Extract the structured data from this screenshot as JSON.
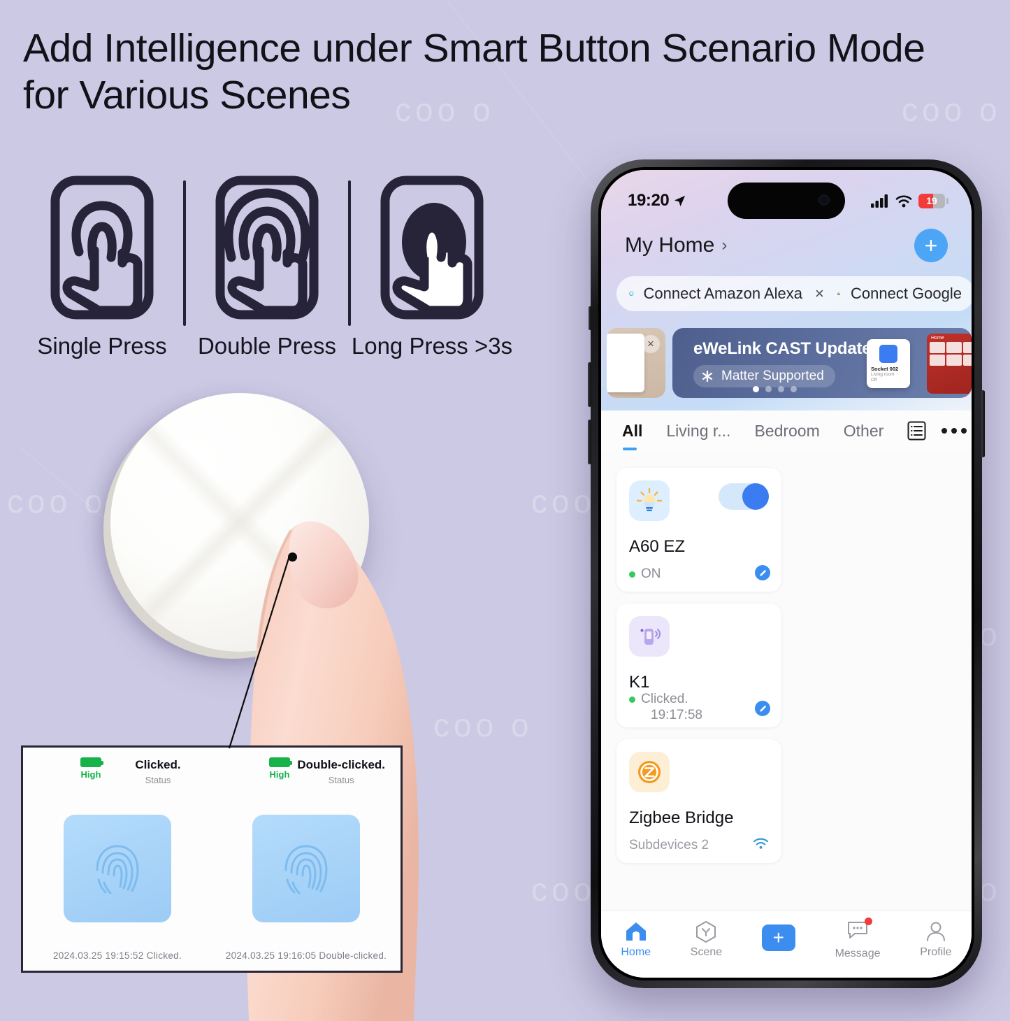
{
  "headline": "Add Intelligence under Smart Button Scenario Mode for Various Scenes",
  "watermark": "coo o",
  "gestures": [
    {
      "label": "Single Press",
      "icon": "single-press-icon"
    },
    {
      "label": "Double Press",
      "icon": "double-press-icon"
    },
    {
      "label": "Long Press >3s",
      "icon": "long-press-icon"
    }
  ],
  "inset_panel": {
    "entries": [
      {
        "battery_label": "High",
        "status_value": "Clicked.",
        "status_label": "Status",
        "tile_icon": "fingerprint-icon",
        "log": "2024.03.25  19:15:52  Clicked."
      },
      {
        "battery_label": "High",
        "status_value": "Double-clicked.",
        "status_label": "Status",
        "tile_icon": "fingerprint-icon",
        "log": "2024.03.25  19:16:05  Double-clicked."
      }
    ]
  },
  "phone": {
    "status_bar": {
      "time": "19:20",
      "location_icon": "location-arrow-icon",
      "signal_icon": "cellular-signal-icon",
      "wifi_icon": "wifi-icon",
      "battery_percent": "19"
    },
    "header": {
      "title": "My Home",
      "chevron": "›",
      "add_button": "+"
    },
    "connect_row": {
      "alexa_label": "Connect Amazon Alexa",
      "alexa_icon": "amazon-alexa-icon",
      "close_icon": "×",
      "google_label": "Connect Google",
      "google_icon": "google-home-icon"
    },
    "banner": {
      "title": "eWeLink CAST Update",
      "chip_label": "Matter Supported",
      "chip_icon": "matter-icon",
      "dots_total": 4,
      "dots_active": 1,
      "inner_card": {
        "name": "Socket 002",
        "room": "Living room",
        "state": "Off"
      },
      "right_photo_label": "Home"
    },
    "tabs": [
      {
        "label": "All",
        "active": true
      },
      {
        "label": "Living r...",
        "active": false
      },
      {
        "label": "Bedroom",
        "active": false
      },
      {
        "label": "Other",
        "active": false
      }
    ],
    "tabs_right": {
      "list_icon": "list-view-icon",
      "more_icon": "more-dots-icon"
    },
    "devices": [
      {
        "name": "A60 EZ",
        "icon": "light-bulb-icon",
        "status": "ON",
        "status_time": "",
        "has_toggle": true,
        "toggle_on": true,
        "has_edit": true
      },
      {
        "name": "K1",
        "icon": "smart-button-icon",
        "status": "Clicked.",
        "status_time": "19:17:58",
        "has_toggle": false,
        "toggle_on": false,
        "has_edit": true
      },
      {
        "name": "Zigbee Bridge",
        "icon": "zigbee-icon",
        "status": "Subdevices 2",
        "status_time": "",
        "has_toggle": false,
        "toggle_on": false,
        "has_edit": false
      }
    ],
    "tabbar": [
      {
        "label": "Home",
        "icon": "home-icon",
        "active": true,
        "badge": false
      },
      {
        "label": "Scene",
        "icon": "scene-hexagon-icon",
        "active": false,
        "badge": false
      },
      {
        "label": "",
        "icon": "add-plus-icon",
        "active": false,
        "badge": false
      },
      {
        "label": "Message",
        "icon": "message-bubble-icon",
        "active": false,
        "badge": true
      },
      {
        "label": "Profile",
        "icon": "profile-person-icon",
        "active": false,
        "badge": false
      }
    ]
  },
  "colors": {
    "background": "#cbc9e4",
    "accent_blue": "#3b8ef0",
    "toggle_blue": "#3b7df0",
    "status_green": "#36c95f",
    "battery_red": "#f23b3b",
    "ink": "#131118"
  }
}
